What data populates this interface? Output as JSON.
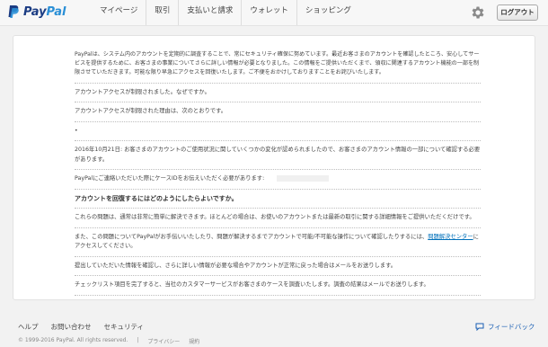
{
  "brand": {
    "logo_pay": "Pay",
    "logo_pal": "Pal"
  },
  "nav": {
    "items": [
      {
        "label": "マイページ"
      },
      {
        "label": "取引"
      },
      {
        "label": "支払いと請求"
      },
      {
        "label": "ウォレット"
      },
      {
        "label": "ショッピング"
      }
    ],
    "logout_label": "ログアウト"
  },
  "content": {
    "intro": "PayPalは、システム内のアカウントを定期的に調査することで、常にセキュリティ確保に努めています。最近お客さまのアカウントを確認したところ、安心してサービスを提供するために、お客さまの事業についてさらに詳しい情報が必要となりました。この情報をご提供いただくまで、領収に関連するアカウント機能の一部を制限させていただきます。可能な限り早急にアクセスを回復いたします。ご不便をおかけしておりますことをお詫びいたします。",
    "limited": "アカウントアクセスが制限されました。なぜですか。",
    "reason_intro": "アカウントアクセスが制限された理由は、次のとおりです。",
    "bullet": "•",
    "reason": "2016年10月21日: お客さまのアカウントのご使用状況に関していくつかの変化が認められましたので、お客さまのアカウント情報の一部について確認する必要があります。",
    "case_line": "PayPalにご連絡いただいた際にケースIDをお伝えいただく必要があります:",
    "heading": "アカウントを回復するにはどのようにしたらよいですか。",
    "p1": "これらの問題は、通常は非常に簡単に解決できます。ほとんどの場合は、お使いのアカウントまたは最新の取引に関する詳細情報をご提供いただくだけです。",
    "p2_before": "また、この問題についてPayPalがお手伝いいたしたり、問題が解決するまでアカウントで可能/不可能な操作について確認したりするには、",
    "p2_link": "問題解決センター",
    "p2_after": "にアクセスしてください。",
    "p3": "提出していただいた情報を確認し、さらに詳しい情報が必要な場合やアカウントが正常に戻った場合はメールをお送りします。",
    "p4": "チェックリスト項目を完了すると、当社のカスタマーサービスがお客さまのケースを調査いたします。調査の結果はメールでお送りします。"
  },
  "footer": {
    "links": [
      "ヘルプ",
      "お問い合わせ",
      "セキュリティ"
    ],
    "feedback": "フィードバック",
    "copyright": "© 1999-2016 PayPal. All rights reserved.",
    "divider": "|",
    "privacy": "プライバシー",
    "terms": "規約"
  },
  "colors": {
    "brand_dark": "#1b3c83",
    "brand_light": "#2a8fd6",
    "link": "#0070ba"
  }
}
